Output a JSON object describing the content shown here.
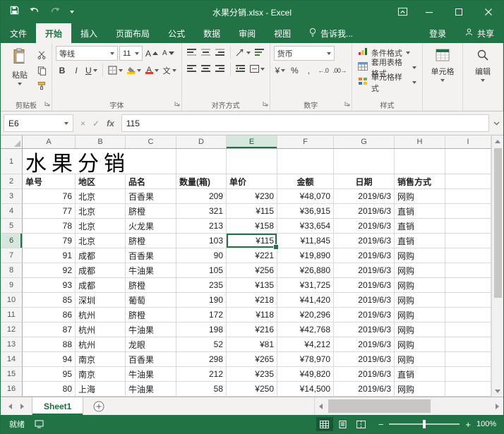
{
  "colors": {
    "accent": "#217346"
  },
  "titlebar": {
    "title": "水果分销.xlsx - Excel"
  },
  "tabs": [
    {
      "label": "文件"
    },
    {
      "label": "开始",
      "active": true
    },
    {
      "label": "插入"
    },
    {
      "label": "页面布局"
    },
    {
      "label": "公式"
    },
    {
      "label": "数据"
    },
    {
      "label": "审阅"
    },
    {
      "label": "视图"
    }
  ],
  "tellme": "告诉我...",
  "signin": "登录",
  "share": "共享",
  "ribbon": {
    "paste": "粘贴",
    "font_name": "等线",
    "font_size": "11",
    "bold": "B",
    "italic": "I",
    "underline": "U",
    "letter_a": "A",
    "phonetic": "文",
    "number_format": "货币",
    "currency": "¥",
    "percent": "%",
    "comma": ",",
    "inc_decimal": "←.0",
    "dec_decimal": ".00→",
    "cond_format": "条件格式",
    "table_format": "套用表格格式",
    "cell_styles": "单元格样式",
    "cells": "单元格",
    "editing": "编辑",
    "groups": {
      "clipboard": "剪贴板",
      "font": "字体",
      "align": "对齐方式",
      "number": "数字",
      "styles": "样式"
    }
  },
  "formula_bar": {
    "name_box": "E6",
    "cancel": "×",
    "enter": "✓",
    "fx": "fx",
    "value": "115"
  },
  "sheet": {
    "columns": [
      "A",
      "B",
      "C",
      "D",
      "E",
      "F",
      "G",
      "H",
      "I"
    ],
    "title_cell": "水果分销",
    "headers": [
      "单号",
      "地区",
      "品名",
      "数量(箱)",
      "单价",
      "金额",
      "日期",
      "销售方式"
    ],
    "rows": [
      [
        "76",
        "北京",
        "百香果",
        "209",
        "¥230",
        "¥48,070",
        "2019/6/3",
        "网购"
      ],
      [
        "77",
        "北京",
        "脐橙",
        "321",
        "¥115",
        "¥36,915",
        "2019/6/3",
        "直销"
      ],
      [
        "78",
        "北京",
        "火龙果",
        "213",
        "¥158",
        "¥33,654",
        "2019/6/3",
        "直销"
      ],
      [
        "79",
        "北京",
        "脐橙",
        "103",
        "¥115",
        "¥11,845",
        "2019/6/3",
        "直销"
      ],
      [
        "91",
        "成都",
        "百香果",
        "90",
        "¥221",
        "¥19,890",
        "2019/6/3",
        "网购"
      ],
      [
        "92",
        "成都",
        "牛油果",
        "105",
        "¥256",
        "¥26,880",
        "2019/6/3",
        "网购"
      ],
      [
        "93",
        "成都",
        "脐橙",
        "235",
        "¥135",
        "¥31,725",
        "2019/6/3",
        "网购"
      ],
      [
        "85",
        "深圳",
        "葡萄",
        "190",
        "¥218",
        "¥41,420",
        "2019/6/3",
        "网购"
      ],
      [
        "86",
        "杭州",
        "脐橙",
        "172",
        "¥118",
        "¥20,296",
        "2019/6/3",
        "网购"
      ],
      [
        "87",
        "杭州",
        "牛油果",
        "198",
        "¥216",
        "¥42,768",
        "2019/6/3",
        "网购"
      ],
      [
        "88",
        "杭州",
        "龙眼",
        "52",
        "¥81",
        "¥4,212",
        "2019/6/3",
        "网购"
      ],
      [
        "94",
        "南京",
        "百香果",
        "298",
        "¥265",
        "¥78,970",
        "2019/6/3",
        "网购"
      ],
      [
        "95",
        "南京",
        "牛油果",
        "212",
        "¥235",
        "¥49,820",
        "2019/6/3",
        "直销"
      ],
      [
        "80",
        "上海",
        "牛油果",
        "58",
        "¥250",
        "¥14,500",
        "2019/6/3",
        "网购"
      ]
    ],
    "selected_cell": "E6"
  },
  "sheet_tabs": {
    "active": "Sheet1"
  },
  "status": {
    "mode": "就绪",
    "zoom": "100%",
    "zoom_out": "−",
    "zoom_in": "+"
  }
}
